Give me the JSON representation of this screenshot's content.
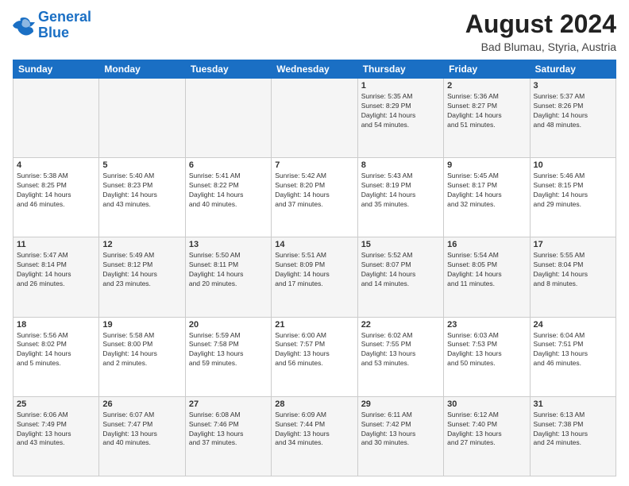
{
  "header": {
    "logo_line1": "General",
    "logo_line2": "Blue",
    "month_year": "August 2024",
    "location": "Bad Blumau, Styria, Austria"
  },
  "weekdays": [
    "Sunday",
    "Monday",
    "Tuesday",
    "Wednesday",
    "Thursday",
    "Friday",
    "Saturday"
  ],
  "weeks": [
    [
      {
        "day": "",
        "info": ""
      },
      {
        "day": "",
        "info": ""
      },
      {
        "day": "",
        "info": ""
      },
      {
        "day": "",
        "info": ""
      },
      {
        "day": "1",
        "info": "Sunrise: 5:35 AM\nSunset: 8:29 PM\nDaylight: 14 hours\nand 54 minutes."
      },
      {
        "day": "2",
        "info": "Sunrise: 5:36 AM\nSunset: 8:27 PM\nDaylight: 14 hours\nand 51 minutes."
      },
      {
        "day": "3",
        "info": "Sunrise: 5:37 AM\nSunset: 8:26 PM\nDaylight: 14 hours\nand 48 minutes."
      }
    ],
    [
      {
        "day": "4",
        "info": "Sunrise: 5:38 AM\nSunset: 8:25 PM\nDaylight: 14 hours\nand 46 minutes."
      },
      {
        "day": "5",
        "info": "Sunrise: 5:40 AM\nSunset: 8:23 PM\nDaylight: 14 hours\nand 43 minutes."
      },
      {
        "day": "6",
        "info": "Sunrise: 5:41 AM\nSunset: 8:22 PM\nDaylight: 14 hours\nand 40 minutes."
      },
      {
        "day": "7",
        "info": "Sunrise: 5:42 AM\nSunset: 8:20 PM\nDaylight: 14 hours\nand 37 minutes."
      },
      {
        "day": "8",
        "info": "Sunrise: 5:43 AM\nSunset: 8:19 PM\nDaylight: 14 hours\nand 35 minutes."
      },
      {
        "day": "9",
        "info": "Sunrise: 5:45 AM\nSunset: 8:17 PM\nDaylight: 14 hours\nand 32 minutes."
      },
      {
        "day": "10",
        "info": "Sunrise: 5:46 AM\nSunset: 8:15 PM\nDaylight: 14 hours\nand 29 minutes."
      }
    ],
    [
      {
        "day": "11",
        "info": "Sunrise: 5:47 AM\nSunset: 8:14 PM\nDaylight: 14 hours\nand 26 minutes."
      },
      {
        "day": "12",
        "info": "Sunrise: 5:49 AM\nSunset: 8:12 PM\nDaylight: 14 hours\nand 23 minutes."
      },
      {
        "day": "13",
        "info": "Sunrise: 5:50 AM\nSunset: 8:11 PM\nDaylight: 14 hours\nand 20 minutes."
      },
      {
        "day": "14",
        "info": "Sunrise: 5:51 AM\nSunset: 8:09 PM\nDaylight: 14 hours\nand 17 minutes."
      },
      {
        "day": "15",
        "info": "Sunrise: 5:52 AM\nSunset: 8:07 PM\nDaylight: 14 hours\nand 14 minutes."
      },
      {
        "day": "16",
        "info": "Sunrise: 5:54 AM\nSunset: 8:05 PM\nDaylight: 14 hours\nand 11 minutes."
      },
      {
        "day": "17",
        "info": "Sunrise: 5:55 AM\nSunset: 8:04 PM\nDaylight: 14 hours\nand 8 minutes."
      }
    ],
    [
      {
        "day": "18",
        "info": "Sunrise: 5:56 AM\nSunset: 8:02 PM\nDaylight: 14 hours\nand 5 minutes."
      },
      {
        "day": "19",
        "info": "Sunrise: 5:58 AM\nSunset: 8:00 PM\nDaylight: 14 hours\nand 2 minutes."
      },
      {
        "day": "20",
        "info": "Sunrise: 5:59 AM\nSunset: 7:58 PM\nDaylight: 13 hours\nand 59 minutes."
      },
      {
        "day": "21",
        "info": "Sunrise: 6:00 AM\nSunset: 7:57 PM\nDaylight: 13 hours\nand 56 minutes."
      },
      {
        "day": "22",
        "info": "Sunrise: 6:02 AM\nSunset: 7:55 PM\nDaylight: 13 hours\nand 53 minutes."
      },
      {
        "day": "23",
        "info": "Sunrise: 6:03 AM\nSunset: 7:53 PM\nDaylight: 13 hours\nand 50 minutes."
      },
      {
        "day": "24",
        "info": "Sunrise: 6:04 AM\nSunset: 7:51 PM\nDaylight: 13 hours\nand 46 minutes."
      }
    ],
    [
      {
        "day": "25",
        "info": "Sunrise: 6:06 AM\nSunset: 7:49 PM\nDaylight: 13 hours\nand 43 minutes."
      },
      {
        "day": "26",
        "info": "Sunrise: 6:07 AM\nSunset: 7:47 PM\nDaylight: 13 hours\nand 40 minutes."
      },
      {
        "day": "27",
        "info": "Sunrise: 6:08 AM\nSunset: 7:46 PM\nDaylight: 13 hours\nand 37 minutes."
      },
      {
        "day": "28",
        "info": "Sunrise: 6:09 AM\nSunset: 7:44 PM\nDaylight: 13 hours\nand 34 minutes."
      },
      {
        "day": "29",
        "info": "Sunrise: 6:11 AM\nSunset: 7:42 PM\nDaylight: 13 hours\nand 30 minutes."
      },
      {
        "day": "30",
        "info": "Sunrise: 6:12 AM\nSunset: 7:40 PM\nDaylight: 13 hours\nand 27 minutes."
      },
      {
        "day": "31",
        "info": "Sunrise: 6:13 AM\nSunset: 7:38 PM\nDaylight: 13 hours\nand 24 minutes."
      }
    ]
  ]
}
